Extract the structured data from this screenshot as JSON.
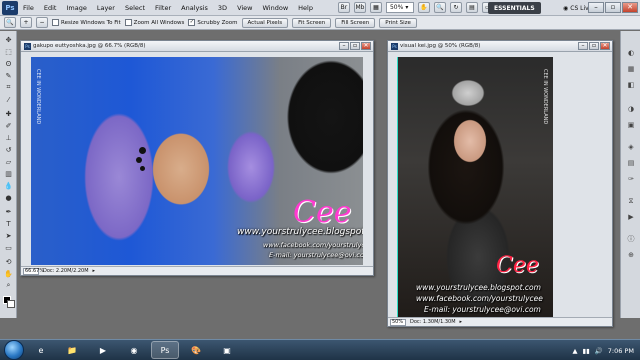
{
  "menubar": {
    "logo": "Ps",
    "items": [
      "File",
      "Edit",
      "Image",
      "Layer",
      "Select",
      "Filter",
      "Analysis",
      "3D",
      "View",
      "Window",
      "Help"
    ],
    "zoom": "50%",
    "workspace": "ESSENTIALS",
    "cs_live": "CS Live"
  },
  "optionsbar": {
    "checkboxes": [
      {
        "label": "Resize Windows To Fit",
        "checked": false
      },
      {
        "label": "Zoom All Windows",
        "checked": false
      },
      {
        "label": "Scrubby Zoom",
        "checked": true
      }
    ],
    "buttons": [
      "Actual Pixels",
      "Fit Screen",
      "Fill Screen",
      "Print Size"
    ]
  },
  "doc_left": {
    "title": "gakupo euttyoshka.jpg @ 66.7% (RGB/8)",
    "zoom": "66.67%",
    "doc_info": "Doc: 2.20M/2.20M",
    "watermark": {
      "name": "Cee",
      "lines": [
        "www.yourstrulycee.blogspot.com",
        "www.facebook.com/yourstrulycee",
        "E-mail: yourstrulycee@ovi.com"
      ],
      "vertical": "CEE IN WONDERLAND"
    }
  },
  "doc_right": {
    "title": "visual kei.jpg @ 50% (RGB/8)",
    "zoom": "50%",
    "doc_info": "Doc: 1.30M/1.30M",
    "watermark": {
      "name": "Cee",
      "lines": [
        "www.yourstrulycee.blogspot.com",
        "www.facebook.com/yourstrulycee",
        "E-mail: yourstrulycee@ovi.com"
      ],
      "vertical": "CEE IN WONDERLAND"
    }
  },
  "taskbar": {
    "apps": [
      "ie-icon",
      "explorer-icon",
      "media-player-icon",
      "chrome-icon",
      "photoshop-icon",
      "paint-icon",
      "app-icon"
    ],
    "time": "7:06 PM"
  },
  "colors": {
    "accent": "#ff3ad0",
    "menubar": "#d9dde4",
    "taskbar": "#2c445c"
  }
}
